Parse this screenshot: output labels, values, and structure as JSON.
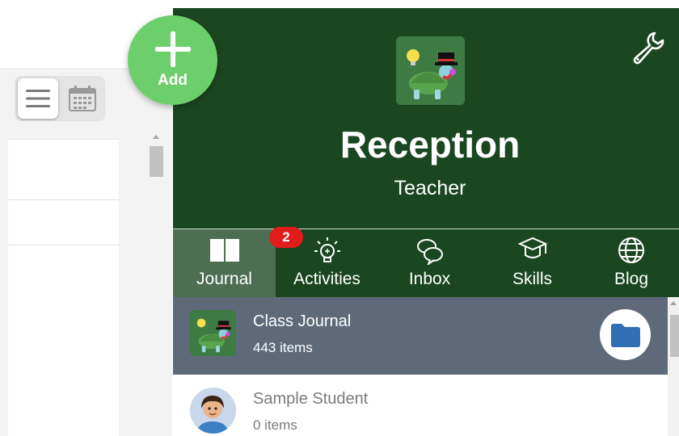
{
  "add_button": {
    "label": "Add"
  },
  "header": {
    "class_name": "Reception",
    "role": "Teacher"
  },
  "nav": {
    "tabs": [
      {
        "label": "Journal",
        "icon": "book-icon",
        "active": true
      },
      {
        "label": "Activities",
        "icon": "lightbulb-icon",
        "active": false
      },
      {
        "label": "Inbox",
        "icon": "chat-bubbles-icon",
        "active": false,
        "badge": "2"
      },
      {
        "label": "Skills",
        "icon": "graduation-cap-icon",
        "active": false
      },
      {
        "label": "Blog",
        "icon": "globe-icon",
        "active": false
      }
    ]
  },
  "journal_list": {
    "items": [
      {
        "name": "Class Journal",
        "count": "443 items",
        "selected": true
      },
      {
        "name": "Sample Student",
        "count": "0 items",
        "selected": false
      }
    ]
  },
  "colors": {
    "header_bg": "#1b4720",
    "active_tab": "#4d6e50",
    "add_button": "#6dcf6b",
    "selected_row": "#5e6a7a",
    "badge": "#e21b1b",
    "folder_icon": "#2f6fb3"
  }
}
